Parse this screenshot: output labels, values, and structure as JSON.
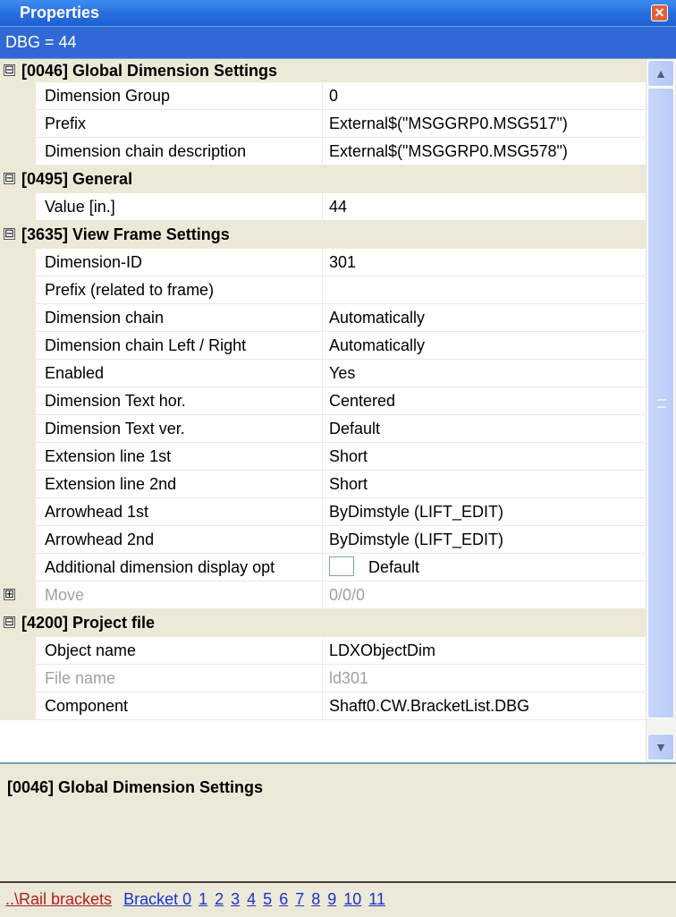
{
  "window": {
    "title": "Properties"
  },
  "subtitle": "DBG = 44",
  "first_category": {
    "label": "[0046] Global Dimension Settings",
    "expander": "⊟"
  },
  "groups": [
    {
      "type": "row",
      "name": "Dimension Group",
      "value": "0"
    },
    {
      "type": "row",
      "name": "Prefix",
      "value": "External$(\"MSGGRP0.MSG517\")"
    },
    {
      "type": "row",
      "name": "Dimension chain description",
      "value": "External$(\"MSGGRP0.MSG578\")"
    },
    {
      "type": "cat",
      "label": "[0495] General",
      "expander": "⊟"
    },
    {
      "type": "row",
      "name": "Value [in.]",
      "value": "44"
    },
    {
      "type": "cat",
      "label": "[3635] View Frame Settings",
      "expander": "⊟"
    },
    {
      "type": "row",
      "name": "Dimension-ID",
      "value": "301"
    },
    {
      "type": "row",
      "name": "Prefix (related to frame)",
      "value": ""
    },
    {
      "type": "row",
      "name": "Dimension chain",
      "value": "Automatically"
    },
    {
      "type": "row",
      "name": "Dimension chain Left / Right",
      "value": "Automatically"
    },
    {
      "type": "row",
      "name": "Enabled",
      "value": "Yes"
    },
    {
      "type": "row",
      "name": "Dimension Text hor.",
      "value": "Centered"
    },
    {
      "type": "row",
      "name": "Dimension Text ver.",
      "value": "Default"
    },
    {
      "type": "row",
      "name": "Extension line 1st",
      "value": "Short"
    },
    {
      "type": "row",
      "name": "Extension line 2nd",
      "value": "Short"
    },
    {
      "type": "row",
      "name": "Arrowhead 1st",
      "value": "ByDimstyle (LIFT_EDIT)"
    },
    {
      "type": "row",
      "name": "Arrowhead 2nd",
      "value": "ByDimstyle (LIFT_EDIT)"
    },
    {
      "type": "row-check",
      "name": "Additional dimension display opt",
      "value": "Default"
    },
    {
      "type": "row-exp",
      "name": "Move",
      "value": "0/0/0",
      "disabled": true,
      "expander": "⊞"
    },
    {
      "type": "cat",
      "label": "[4200] Project file",
      "expander": "⊟"
    },
    {
      "type": "row",
      "name": "Object name",
      "value": "LDXObjectDim"
    },
    {
      "type": "row",
      "name": "File name",
      "value": "ld301",
      "disabled": true
    },
    {
      "type": "row",
      "name": "Component",
      "value": "Shaft0.CW.BracketList.DBG"
    }
  ],
  "description": {
    "title": "[0046] Global Dimension Settings"
  },
  "links": {
    "crumb": "..\\Rail brackets",
    "items": [
      "Bracket 0",
      "1",
      "2",
      "3",
      "4",
      "5",
      "6",
      "7",
      "8",
      "9",
      "10",
      "11"
    ]
  },
  "scrollbar": {
    "up": "▲",
    "down": "▼"
  },
  "close_glyph": "✕"
}
